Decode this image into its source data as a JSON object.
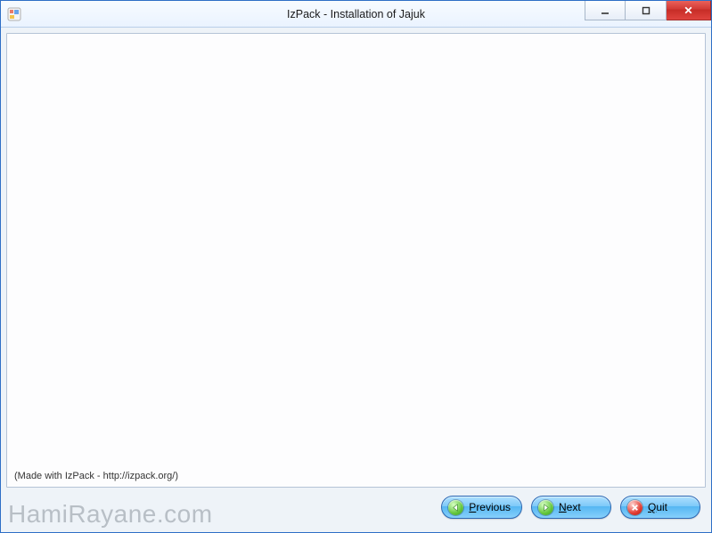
{
  "titlebar": {
    "title": "IzPack - Installation of Jajuk"
  },
  "footer": {
    "made_with": "(Made with IzPack - http://izpack.org/)"
  },
  "buttons": {
    "previous_active_letter": "P",
    "previous_rest": "revious",
    "next_active_letter": "N",
    "next_rest": "ext",
    "quit_active_letter": "Q",
    "quit_rest": "uit"
  },
  "watermark": "HamiRayane.com"
}
